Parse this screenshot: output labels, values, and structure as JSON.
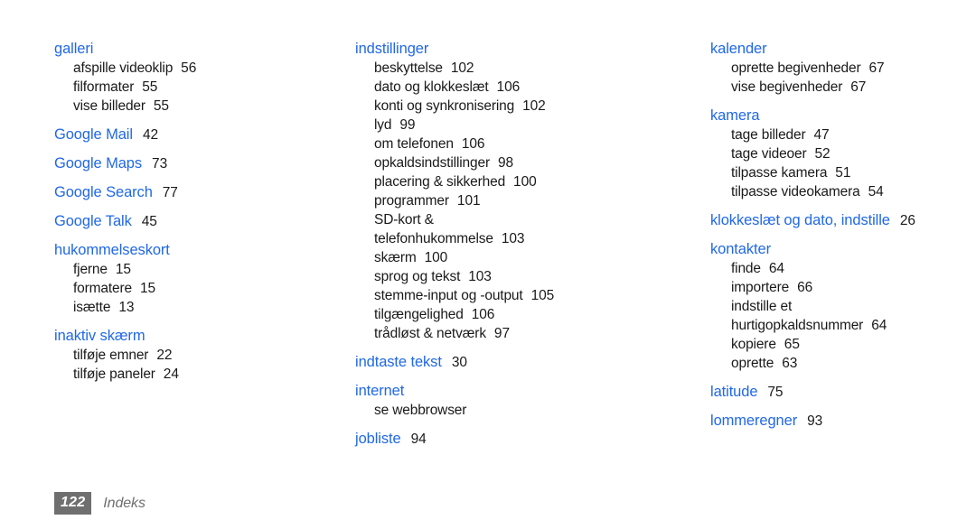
{
  "document": {
    "title": "Indeks",
    "page_number": "122",
    "language": "da",
    "accent_color": "#2068e8",
    "text_color": "#1a1a1a",
    "footer_color": "#6f6f6f"
  },
  "footer": {
    "page_number": "122",
    "section_label": "Indeks"
  },
  "columns": [
    {
      "id": "column-1",
      "entries": [
        {
          "type": "head",
          "label": "galleri",
          "page": ""
        },
        {
          "type": "sub",
          "label": "afspille videoklip",
          "page": "56"
        },
        {
          "type": "sub",
          "label": "filformater",
          "page": "55"
        },
        {
          "type": "sub",
          "label": "vise billeder",
          "page": "55"
        },
        {
          "type": "head",
          "label": "Google Mail",
          "page": "42"
        },
        {
          "type": "head",
          "label": "Google Maps",
          "page": "73"
        },
        {
          "type": "head",
          "label": "Google Search",
          "page": "77"
        },
        {
          "type": "head",
          "label": "Google Talk",
          "page": "45"
        },
        {
          "type": "head",
          "label": "hukommelseskort",
          "page": ""
        },
        {
          "type": "sub",
          "label": "fjerne",
          "page": "15"
        },
        {
          "type": "sub",
          "label": "formatere",
          "page": "15"
        },
        {
          "type": "sub",
          "label": "isætte",
          "page": "13"
        },
        {
          "type": "head",
          "label": "inaktiv skærm",
          "page": ""
        },
        {
          "type": "sub",
          "label": "tilføje emner",
          "page": "22"
        },
        {
          "type": "sub",
          "label": "tilføje paneler",
          "page": "24"
        }
      ]
    },
    {
      "id": "column-2",
      "entries": [
        {
          "type": "head",
          "label": "indstillinger",
          "page": ""
        },
        {
          "type": "sub",
          "label": "beskyttelse",
          "page": "102"
        },
        {
          "type": "sub",
          "label": "dato og klokkeslæt",
          "page": "106"
        },
        {
          "type": "sub",
          "label": "konti og synkronisering",
          "page": "102"
        },
        {
          "type": "sub",
          "label": "lyd",
          "page": "99"
        },
        {
          "type": "sub",
          "label": "om telefonen",
          "page": "106"
        },
        {
          "type": "sub",
          "label": "opkaldsindstillinger",
          "page": "98"
        },
        {
          "type": "sub",
          "label": "placering & sikkerhed",
          "page": "100"
        },
        {
          "type": "sub",
          "label": "programmer",
          "page": "101"
        },
        {
          "type": "sub",
          "label": "SD-kort &",
          "page": ""
        },
        {
          "type": "sub",
          "label": "telefonhukommelse",
          "page": "103"
        },
        {
          "type": "sub",
          "label": "skærm",
          "page": "100"
        },
        {
          "type": "sub",
          "label": "sprog og tekst",
          "page": "103"
        },
        {
          "type": "sub",
          "label": "stemme-input og -output",
          "page": "105"
        },
        {
          "type": "sub",
          "label": "tilgængelighed",
          "page": "106"
        },
        {
          "type": "sub",
          "label": "trådløst & netværk",
          "page": "97"
        },
        {
          "type": "head",
          "label": "indtaste tekst",
          "page": "30"
        },
        {
          "type": "head",
          "label": "internet",
          "page": ""
        },
        {
          "type": "sub",
          "label": "se webbrowser",
          "page": ""
        },
        {
          "type": "head",
          "label": "jobliste",
          "page": "94"
        }
      ]
    },
    {
      "id": "column-3",
      "entries": [
        {
          "type": "head",
          "label": "kalender",
          "page": ""
        },
        {
          "type": "sub",
          "label": "oprette begivenheder",
          "page": "67"
        },
        {
          "type": "sub",
          "label": "vise begivenheder",
          "page": "67"
        },
        {
          "type": "head",
          "label": "kamera",
          "page": ""
        },
        {
          "type": "sub",
          "label": "tage billeder",
          "page": "47"
        },
        {
          "type": "sub",
          "label": "tage videoer",
          "page": "52"
        },
        {
          "type": "sub",
          "label": "tilpasse kamera",
          "page": "51"
        },
        {
          "type": "sub",
          "label": "tilpasse videokamera",
          "page": "54"
        },
        {
          "type": "head",
          "label": "klokkeslæt og dato, indstille",
          "page": "26"
        },
        {
          "type": "head",
          "label": "kontakter",
          "page": ""
        },
        {
          "type": "sub",
          "label": "finde",
          "page": "64"
        },
        {
          "type": "sub",
          "label": "importere",
          "page": "66"
        },
        {
          "type": "sub",
          "label": "indstille et",
          "page": ""
        },
        {
          "type": "sub",
          "label": "hurtigopkaldsnummer",
          "page": "64"
        },
        {
          "type": "sub",
          "label": "kopiere",
          "page": "65"
        },
        {
          "type": "sub",
          "label": "oprette",
          "page": "63"
        },
        {
          "type": "head",
          "label": "latitude",
          "page": "75"
        },
        {
          "type": "head",
          "label": "lommeregner",
          "page": "93"
        }
      ]
    }
  ]
}
